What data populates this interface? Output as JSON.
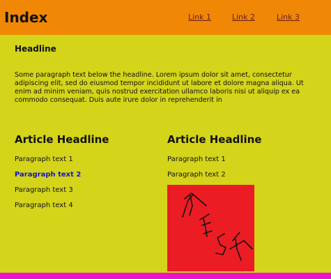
{
  "header": {
    "title": "Index",
    "links": [
      "Link 1",
      "Link 2",
      "Link 3"
    ]
  },
  "main": {
    "headline": "Headline",
    "intro": "Some paragraph text below the headline. Lorem ipsum dolor sit amet, consectetur adipiscing elit, sed do eiusmod tempor incididunt ut labore et dolore magna aliqua. Ut enim ad minim veniam, quis nostrud exercitation ullamco laboris nisi ut aliquip ex ea commodo consequat. Duis aute irure dolor in reprehenderit in"
  },
  "articles": [
    {
      "headline": "Article Headline",
      "paragraphs": [
        "Paragraph text 1",
        "Paragraph text 2",
        "Paragraph text 3",
        "Paragraph text 4"
      ]
    },
    {
      "headline": "Article Headline",
      "paragraphs": [
        "Paragraph text 1",
        "Paragraph text 2"
      ]
    }
  ],
  "colors": {
    "page_background": "#d4d41a",
    "header_background": "#f08805",
    "link": "#6a1a1a",
    "highlight_text": "#1414c8",
    "image_background": "#ec1c24",
    "footer_bar": "#ec14c8"
  }
}
